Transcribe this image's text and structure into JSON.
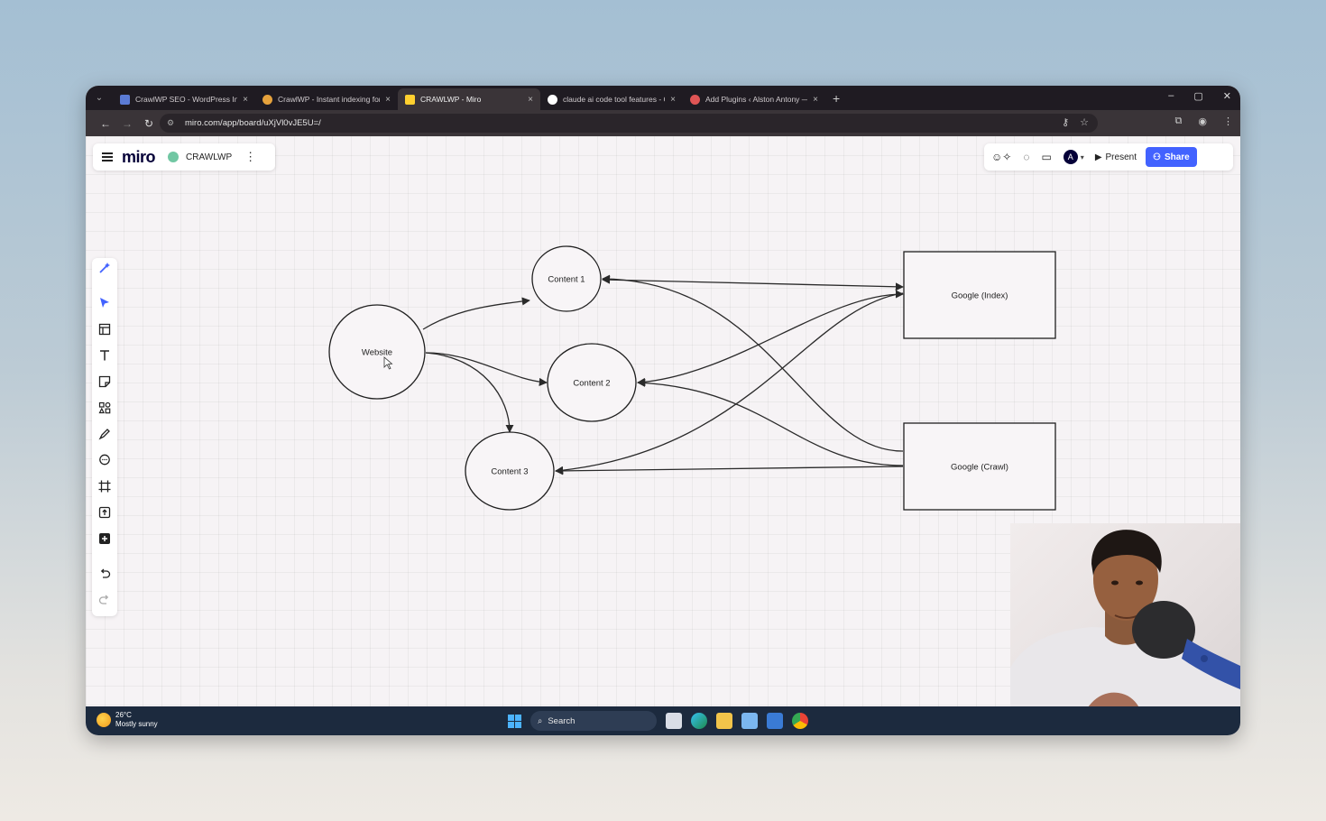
{
  "browser": {
    "tabs": [
      {
        "title": "CrawlWP SEO - WordPress Inst",
        "active": false,
        "favicon_color": "#5b7bd5"
      },
      {
        "title": "CrawlWP - Instant indexing for",
        "active": false,
        "favicon_color": "#e6a23c"
      },
      {
        "title": "CRAWLWP - Miro",
        "active": true,
        "favicon_color": "#ffd02f"
      },
      {
        "title": "claude ai code tool features - G",
        "active": false,
        "favicon_color": "#ffffff"
      },
      {
        "title": "Add Plugins ‹ Alston Antony —",
        "active": false,
        "favicon_color": "#e05555"
      }
    ],
    "tab_close": "×",
    "new_tab": "+",
    "url": "miro.com/app/board/uXjVl0vJE5U=/",
    "window_controls": [
      "–",
      "▢",
      "✕"
    ]
  },
  "miro": {
    "logo": "miro",
    "board_name": "CRAWLWP",
    "present_label": "Present",
    "share_label": "Share",
    "avatar_letter": "A",
    "accent_color": "#4262ff"
  },
  "diagram": {
    "nodes": {
      "website": "Website",
      "content1": "Content 1",
      "content2": "Content 2",
      "content3": "Content 3",
      "google_index": "Google (Index)",
      "google_crawl": "Google (Crawl)"
    }
  },
  "taskbar": {
    "temperature": "26°C",
    "weather": "Mostly sunny",
    "search_label": "Search"
  }
}
